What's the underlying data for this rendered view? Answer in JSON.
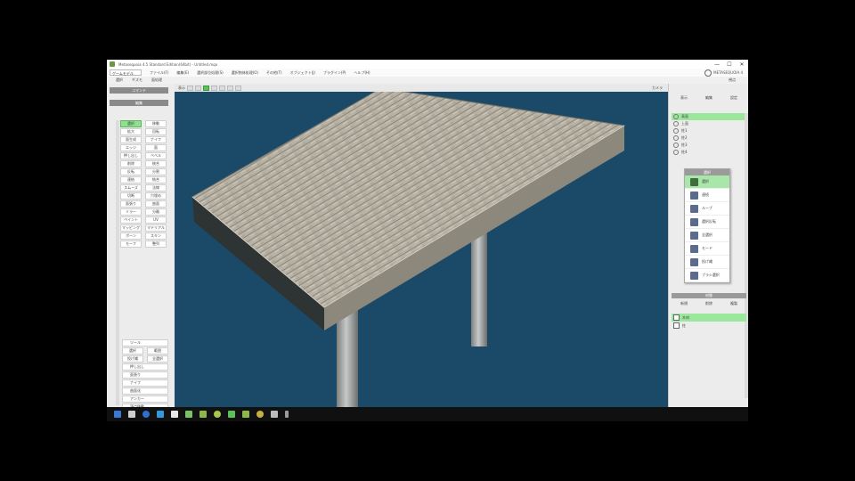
{
  "window": {
    "title": "Metasequoia 4.5 Standard Edition(64bit) - Untitled.mqo",
    "controls": [
      "—",
      "☐",
      "✕"
    ]
  },
  "menu": {
    "dropdown": "ゲームモデル",
    "items": [
      "ファイル(F)",
      "編集(E)",
      "選択部位処理(S)",
      "選択物体処理(O)",
      "その他(T)",
      "オブジェクト(J)",
      "プラグイン(P)",
      "ヘルプ(H)"
    ],
    "logo": "METASEQUOIA 4"
  },
  "toolbar2": {
    "items": [
      "選択",
      "ギズモ",
      "面処理"
    ],
    "right": "視点"
  },
  "left_panel": {
    "header1": "コマンド",
    "header2": "編集",
    "buttons": [
      [
        "選択",
        "移動"
      ],
      [
        "拡大",
        "回転"
      ],
      [
        "面生成",
        "ナイフ"
      ],
      [
        "エッジ",
        "面"
      ],
      [
        "押し出し",
        "ベベル"
      ],
      [
        "削除",
        "統合"
      ],
      [
        "反転",
        "分割"
      ],
      [
        "連結",
        "結合"
      ],
      [
        "スムーズ",
        "法線"
      ],
      [
        "切断",
        "穴埋め"
      ],
      [
        "面張り",
        "曲面"
      ],
      [
        "ミラー",
        "分離"
      ],
      [
        "ペイント",
        "UV"
      ],
      [
        "マッピング",
        "マテリアル"
      ],
      [
        "ボーン",
        "スキン"
      ],
      [
        "モーフ",
        "整列"
      ]
    ],
    "tools_header": "ツール",
    "tools": [
      [
        "選択",
        "範囲"
      ],
      [
        "投げ縄",
        "全選択"
      ]
    ],
    "wide_tools": [
      "押し出し",
      "面張り",
      "ナイフ",
      "曲面化",
      "アンカー",
      "頂点移動",
      "スムース",
      "頂点"
    ]
  },
  "view_toolbar": {
    "label": "表示",
    "right": "カメラ"
  },
  "right_panel": {
    "tabs": [
      "表示",
      "編集",
      "設定"
    ],
    "layers": [
      "表面",
      "上面",
      "柱1",
      "柱2",
      "柱3",
      "柱4"
    ],
    "popup_header": "選択",
    "popup_items": [
      "選択",
      "連続",
      "ループ",
      "選択反転",
      "全選択",
      "モード",
      "投げ縄",
      "ブラシ選択"
    ],
    "lower_header": "材質",
    "lower_tabs": [
      "新規",
      "削除",
      "複製"
    ],
    "materials": [
      "木材",
      "柱"
    ]
  },
  "colors": {
    "viewport_bg": "#1b4a68",
    "accent_green": "#8fe08f",
    "wood": "#b9b3a6"
  }
}
